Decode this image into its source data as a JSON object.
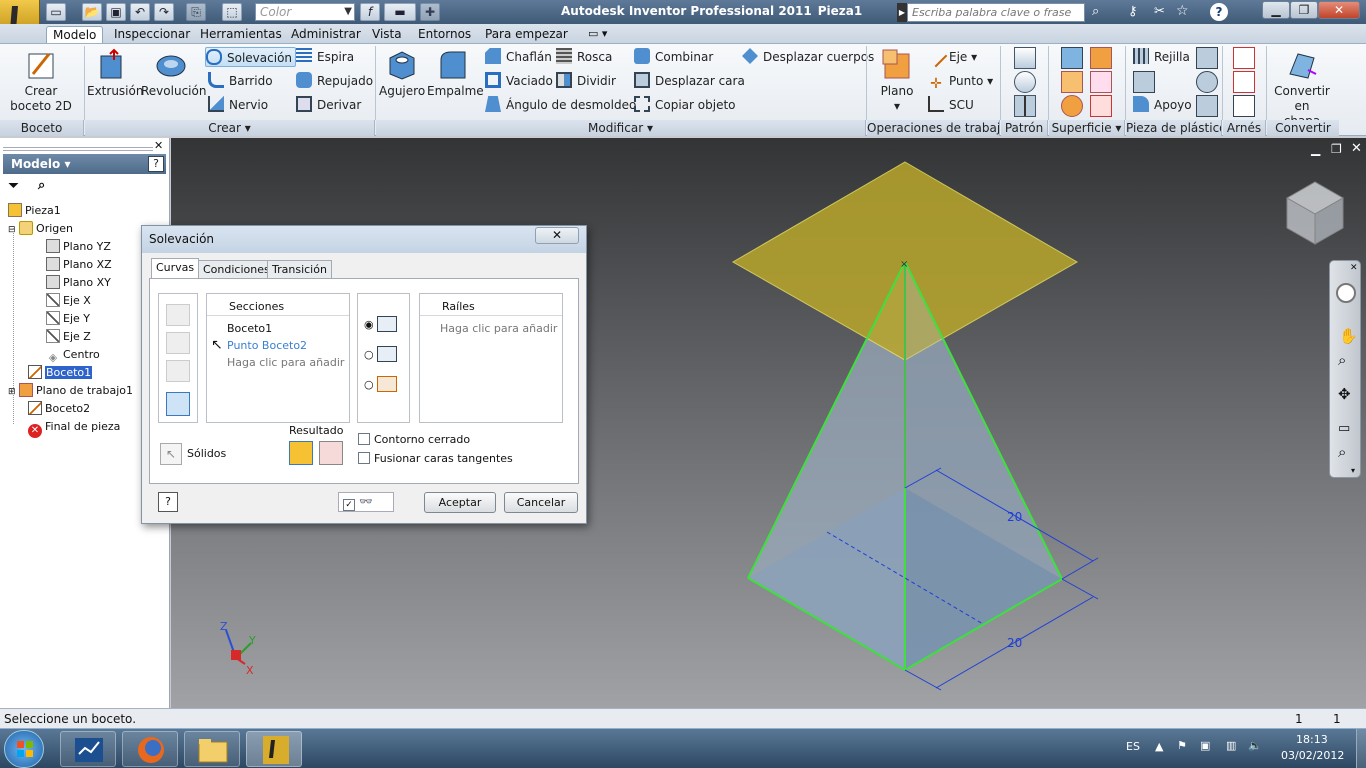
{
  "window": {
    "title": "Autodesk Inventor Professional 2011",
    "document": "Pieza1",
    "color_placeholder": "Color",
    "search_placeholder": "Escriba palabra clave o frase"
  },
  "menu": {
    "tabs": [
      "Modelo",
      "Inspeccionar",
      "Herramientas",
      "Administrar",
      "Vista",
      "Entornos",
      "Para empezar"
    ],
    "active": "Modelo"
  },
  "ribbon": {
    "boceto": {
      "label": "Boceto",
      "create": "Crear",
      "create2": "boceto 2D"
    },
    "crear": {
      "label": "Crear",
      "extrusion": "Extrusión",
      "revolucion": "Revolución",
      "solevacion": "Solevación",
      "barrido": "Barrido",
      "nervio": "Nervio",
      "espira": "Espira",
      "repujado": "Repujado",
      "derivar": "Derivar"
    },
    "modificar": {
      "label": "Modificar",
      "agujero": "Agujero",
      "empalme": "Empalme",
      "chaflan": "Chaflán",
      "vaciado": "Vaciado",
      "angulo": "Ángulo de desmoldeo",
      "rosca": "Rosca",
      "dividir": "Dividir",
      "combinar": "Combinar",
      "desplazar_cara": "Desplazar cara",
      "copiar_objeto": "Copiar objeto",
      "desplazar_cuerpos": "Desplazar cuerpos"
    },
    "operaciones": {
      "label": "Operaciones de trabajo",
      "plano": "Plano",
      "eje": "Eje",
      "punto": "Punto",
      "scu": "SCU"
    },
    "patron": {
      "label": "Patrón"
    },
    "superficie": {
      "label": "Superficie"
    },
    "plastico": {
      "label": "Pieza de plástico",
      "rejilla": "Rejilla",
      "apoyo": "Apoyo"
    },
    "arnes": {
      "label": "Arnés"
    },
    "convertir": {
      "label": "Convertir",
      "btn1": "Convertir en",
      "btn2": "chapa"
    }
  },
  "browser": {
    "title": "Modelo",
    "items": [
      "Pieza1",
      "Origen",
      "Plano YZ",
      "Plano XZ",
      "Plano XY",
      "Eje X",
      "Eje Y",
      "Eje Z",
      "Centro",
      "Boceto1",
      "Plano de trabajo1",
      "Boceto2",
      "Final de pieza"
    ]
  },
  "dialog": {
    "title": "Solevación",
    "tabs": [
      "Curvas",
      "Condiciones",
      "Transición"
    ],
    "secciones_header": "Secciones",
    "secciones": [
      "Boceto1",
      "Punto Boceto2",
      "Haga clic para añadir"
    ],
    "rails_header": "Raíles",
    "rails_hint": "Haga clic para añadir",
    "solidos": "Sólidos",
    "resultado": "Resultado",
    "contorno": "Contorno cerrado",
    "fusionar": "Fusionar caras tangentes",
    "ok": "Aceptar",
    "cancel": "Cancelar",
    "close": "✕",
    "help": "?"
  },
  "viewport": {
    "dim1": "20",
    "dim2": "20",
    "axis_z": "Z",
    "axis_y": "Y",
    "axis_x": "X",
    "colors": {
      "plane": "#c9b836",
      "edge": "#3ee03e",
      "base": "#6f8fb4",
      "dim": "#1e3fd6"
    }
  },
  "status": {
    "message": "Seleccione un boceto.",
    "n1": "1",
    "n2": "1"
  },
  "taskbar": {
    "lang": "ES",
    "time": "18:13",
    "date": "03/02/2012"
  }
}
